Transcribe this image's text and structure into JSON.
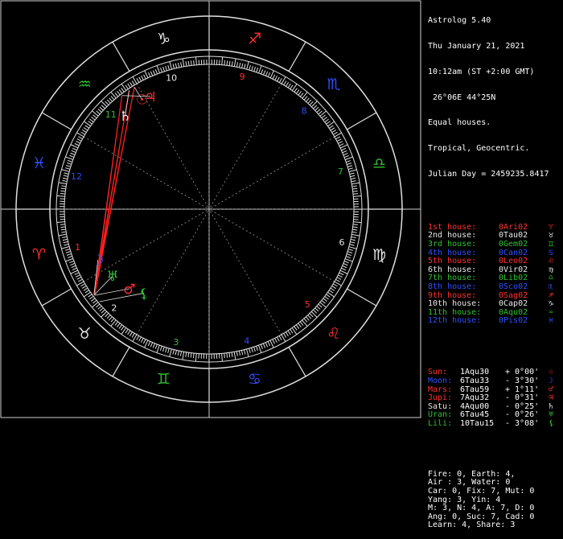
{
  "app": {
    "title": "Astrolog 5.40",
    "date": "Thu January 21, 2021",
    "time": "10:12am (ST +2:00 GMT)",
    "location": " 26°06E 44°25N",
    "house_system": "Equal houses.",
    "zodiac": "Tropical, Geocentric.",
    "julian": "Julian Day = 2459235.8417"
  },
  "colors": {
    "bg": "#000000",
    "white": "#ffffff",
    "grey": "#a0a0a0",
    "red": "#ff3030",
    "darkred": "#c01818",
    "green": "#30c030",
    "blue": "#3050ff",
    "yellow": "#ffff40",
    "orange": "#ff9020"
  },
  "houses": [
    {
      "label": "1st house:",
      "cusp": "0Ari02",
      "glyph": "♈",
      "color": "#ff3030"
    },
    {
      "label": "2nd house:",
      "cusp": "0Tau02",
      "glyph": "♉",
      "color": "#e8e8e8"
    },
    {
      "label": "3rd house:",
      "cusp": "0Gem02",
      "glyph": "♊",
      "color": "#30c030"
    },
    {
      "label": "4th house:",
      "cusp": "0Can02",
      "glyph": "♋",
      "color": "#3050ff"
    },
    {
      "label": "5th house:",
      "cusp": "0Leo02",
      "glyph": "♌",
      "color": "#ff3030"
    },
    {
      "label": "6th house:",
      "cusp": "0Vir02",
      "glyph": "♍",
      "color": "#e8e8e8"
    },
    {
      "label": "7th house:",
      "cusp": "0Lib02",
      "glyph": "♎",
      "color": "#30c030"
    },
    {
      "label": "8th house:",
      "cusp": "0Sco02",
      "glyph": "♏",
      "color": "#3050ff"
    },
    {
      "label": "9th house:",
      "cusp": "0Sag02",
      "glyph": "♐",
      "color": "#ff3030"
    },
    {
      "label": "10th house:",
      "cusp": "0Cap02",
      "glyph": "♑",
      "color": "#e8e8e8"
    },
    {
      "label": "11th house:",
      "cusp": "0Aqu02",
      "glyph": "♒",
      "color": "#30c030"
    },
    {
      "label": "12th house:",
      "cusp": "0Pis02",
      "glyph": "♓",
      "color": "#3050ff"
    }
  ],
  "planets": [
    {
      "label": "Sun:",
      "pos": "1Aqu30",
      "speed": "+ 0°00'",
      "glyph": "☉",
      "color": "#ff3030"
    },
    {
      "label": "Moon:",
      "pos": "6Tau33",
      "speed": "- 3°30'",
      "glyph": "☽",
      "color": "#3050ff"
    },
    {
      "label": "Mars:",
      "pos": "6Tau59",
      "speed": "+ 1°11'",
      "glyph": "♂",
      "color": "#ff3030"
    },
    {
      "label": "Jupi:",
      "pos": "7Aqu32",
      "speed": "- 0°31'",
      "glyph": "♃",
      "color": "#ff3030"
    },
    {
      "label": "Satu:",
      "pos": "4Aqu00",
      "speed": "- 0°25'",
      "glyph": "♄",
      "color": "#e8e8e8"
    },
    {
      "label": "Uran:",
      "pos": "6Tau45",
      "speed": "- 0°26'",
      "glyph": "♅",
      "color": "#30c030"
    },
    {
      "label": "Lili:",
      "pos": "10Tau15",
      "speed": "- 3°08'",
      "glyph": "⚸",
      "color": "#30c030"
    }
  ],
  "stats": [
    "Fire: 0, Earth: 4,",
    "Air : 3, Water: 0",
    "Car: 0, Fix: 7, Mut: 0",
    "Yang: 3, Yin: 4",
    "M: 3, N: 4, A: 7, D: 0",
    "Ang: 0, Suc: 7, Cad: 0",
    "Learn: 4, Share: 3"
  ],
  "wheel": {
    "sign_glyphs": [
      {
        "glyph": "♈",
        "color": "#ff3030"
      },
      {
        "glyph": "♉",
        "color": "#e8e8e8"
      },
      {
        "glyph": "♊",
        "color": "#30c030"
      },
      {
        "glyph": "♋",
        "color": "#3050ff"
      },
      {
        "glyph": "♌",
        "color": "#ff3030"
      },
      {
        "glyph": "♍",
        "color": "#e8e8e8"
      },
      {
        "glyph": "♎",
        "color": "#30c030"
      },
      {
        "glyph": "♏",
        "color": "#3050ff"
      },
      {
        "glyph": "♐",
        "color": "#ff3030"
      },
      {
        "glyph": "♑",
        "color": "#e8e8e8"
      },
      {
        "glyph": "♒",
        "color": "#30c030"
      },
      {
        "glyph": "♓",
        "color": "#3050ff"
      }
    ],
    "house_numbers": [
      {
        "text": "1",
        "color": "#ff3030"
      },
      {
        "text": "2",
        "color": "#e8e8e8"
      },
      {
        "text": "3",
        "color": "#30c030"
      },
      {
        "text": "4",
        "color": "#3050ff"
      },
      {
        "text": "5",
        "color": "#ff3030"
      },
      {
        "text": "6",
        "color": "#e8e8e8"
      },
      {
        "text": "7",
        "color": "#30c030"
      },
      {
        "text": "8",
        "color": "#3050ff"
      },
      {
        "text": "9",
        "color": "#ff3030"
      },
      {
        "text": "10",
        "color": "#e8e8e8"
      },
      {
        "text": "11",
        "color": "#30c030"
      },
      {
        "text": "12",
        "color": "#3050ff"
      }
    ],
    "ascendant_longitude": 0.03,
    "planet_longitudes": [
      301.5,
      36.55,
      36.98,
      307.53,
      304.0,
      36.75,
      40.25
    ]
  }
}
